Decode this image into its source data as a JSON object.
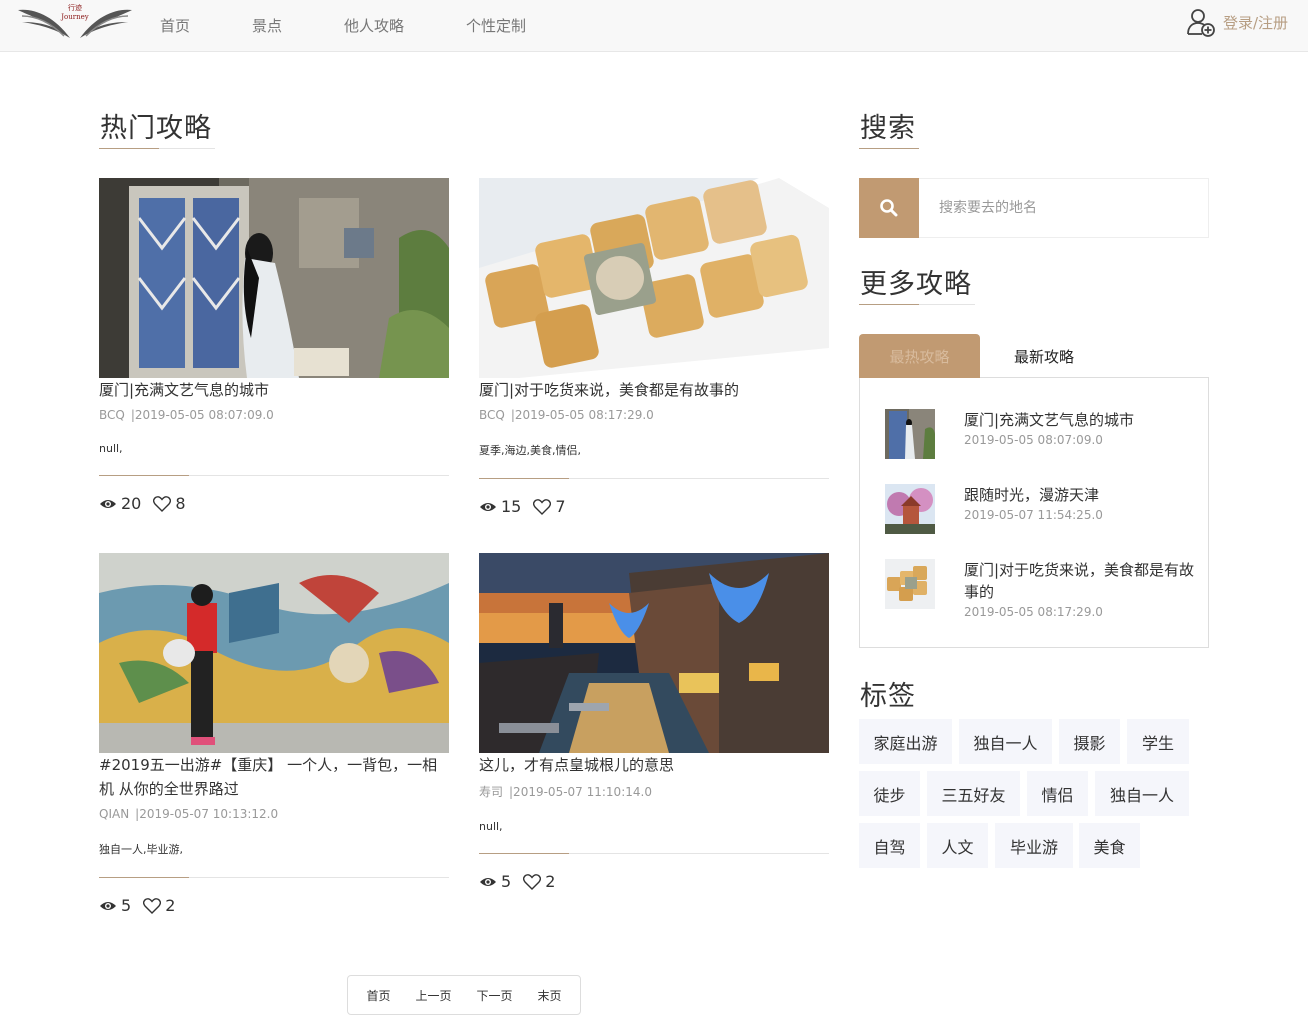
{
  "header": {
    "logo_text": "行迹 Journey",
    "nav": [
      "首页",
      "景点",
      "他人攻略",
      "个性定制"
    ],
    "login_label": "登录/注册",
    "accent_color": "#b79e83"
  },
  "main": {
    "title": "热门攻略",
    "cards": [
      {
        "title": "厦门|充满文艺气息的城市",
        "author": "BCQ",
        "date": "|2019-05-05 08:07:09.0",
        "tags": "null,",
        "views": "20",
        "likes": "8",
        "image": "woman-at-window-photo"
      },
      {
        "title": "厦门|对于吃货来说，美食都是有故事的",
        "author": "BCQ",
        "date": "|2019-05-05 08:17:29.0",
        "tags": "夏季,海边,美食,情侣,",
        "views": "15",
        "likes": "7",
        "image": "pastry-box-photo"
      },
      {
        "title": "#2019五一出游#【重庆】 一个人，一背包，一相机 从你的全世界路过",
        "author": "QIAN",
        "date": "|2019-05-07 10:13:12.0",
        "tags": "独自一人,毕业游,",
        "views": "5",
        "likes": "2",
        "image": "mural-wall-photo"
      },
      {
        "title": "这儿，才有点皇城根儿的意思",
        "author": "寿司",
        "date": "|2019-05-07 11:10:14.0",
        "tags": "null,",
        "views": "5",
        "likes": "2",
        "image": "canal-night-photo"
      }
    ]
  },
  "pagination": [
    "首页",
    "上一页",
    "下一页",
    "末页"
  ],
  "sidebar": {
    "search_title": "搜索",
    "search_placeholder": "搜索要去的地名",
    "more_title": "更多攻略",
    "tabs": [
      "最热攻略",
      "最新攻略"
    ],
    "posts": [
      {
        "title": "厦门|充满文艺气息的城市",
        "date": "2019-05-05 08:07:09.0"
      },
      {
        "title": "跟随时光，漫游天津",
        "date": "2019-05-07 11:54:25.0"
      },
      {
        "title": "厦门|对于吃货来说，美食都是有故事的",
        "date": "2019-05-05 08:17:29.0"
      }
    ],
    "tags_title": "标签",
    "tags": [
      "家庭出游",
      "独自一人",
      "摄影",
      "学生",
      "徒步",
      "三五好友",
      "情侣",
      "独自一人",
      "自驾",
      "人文",
      "毕业游",
      "美食"
    ]
  }
}
